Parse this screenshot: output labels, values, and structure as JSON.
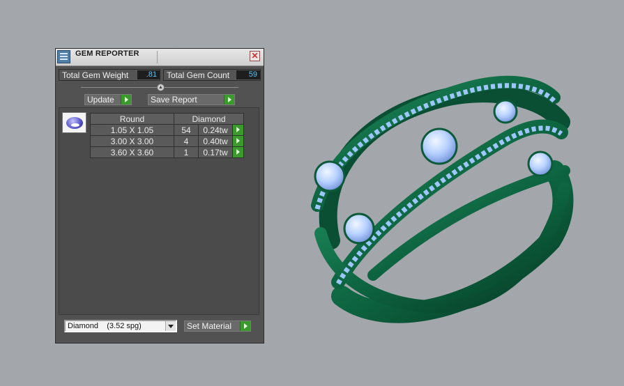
{
  "panel": {
    "title": "GEM REPORTER",
    "total_gem_weight_label": "Total Gem Weight",
    "total_gem_weight_value": ".81",
    "total_gem_count_label": "Total Gem Count",
    "total_gem_count_value": "59",
    "update_label": "Update",
    "save_report_label": "Save Report",
    "table": {
      "headers": [
        "Round",
        "Diamond"
      ],
      "rows": [
        {
          "size": "1.05 X 1.05",
          "count": "54",
          "weight": "0.24tw"
        },
        {
          "size": "3.00 X 3.00",
          "count": "4",
          "weight": "0.40tw"
        },
        {
          "size": "3.60 X 3.60",
          "count": "1",
          "weight": "0.17tw"
        }
      ]
    },
    "material_select_value": "Diamond    (3.52 spg)",
    "set_material_label": "Set Material"
  },
  "colors": {
    "panel_bg": "#525252",
    "viewport_bg": "#a3a7ab",
    "accent_green": "#3a9a2c",
    "value_blue": "#57c7ff",
    "ring_metal": "#0f6a45",
    "gem_blue": "#9fc7ff"
  },
  "icons": [
    "gem-reporter-icon",
    "close-icon",
    "slider-knob-icon",
    "go-arrow-icon",
    "dropdown-arrow-icon",
    "gem-thumbnail-icon"
  ]
}
